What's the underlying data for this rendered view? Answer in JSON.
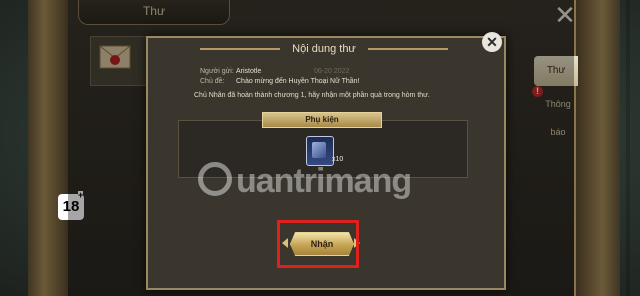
{
  "header": {
    "title": "Thư"
  },
  "side_tabs": {
    "mail": "Thư",
    "notice": "Thông báo",
    "badge": "!"
  },
  "age_rating": {
    "value": "18",
    "plus": "+"
  },
  "dialog": {
    "title": "Nội dung thư",
    "sender_label": "Người gửi:",
    "sender_value": "Aristotle",
    "subject_label": "Chủ đề:",
    "subject_value": "Chào mừng đến Huyền Thoại Nữ Thần!",
    "date": "06-20 2022",
    "message": "Chủ Nhân đã hoàn thành chương 1, hãy nhận một phần quà trong hòm thư.",
    "attachments_title": "Phụ kiện",
    "attachment": {
      "name": "card-item",
      "quantity": "x10"
    },
    "claim_label": "Nhận"
  },
  "watermark": "uantrimang",
  "colors": {
    "highlight": "#e0201c",
    "gold": "#c6a454"
  }
}
